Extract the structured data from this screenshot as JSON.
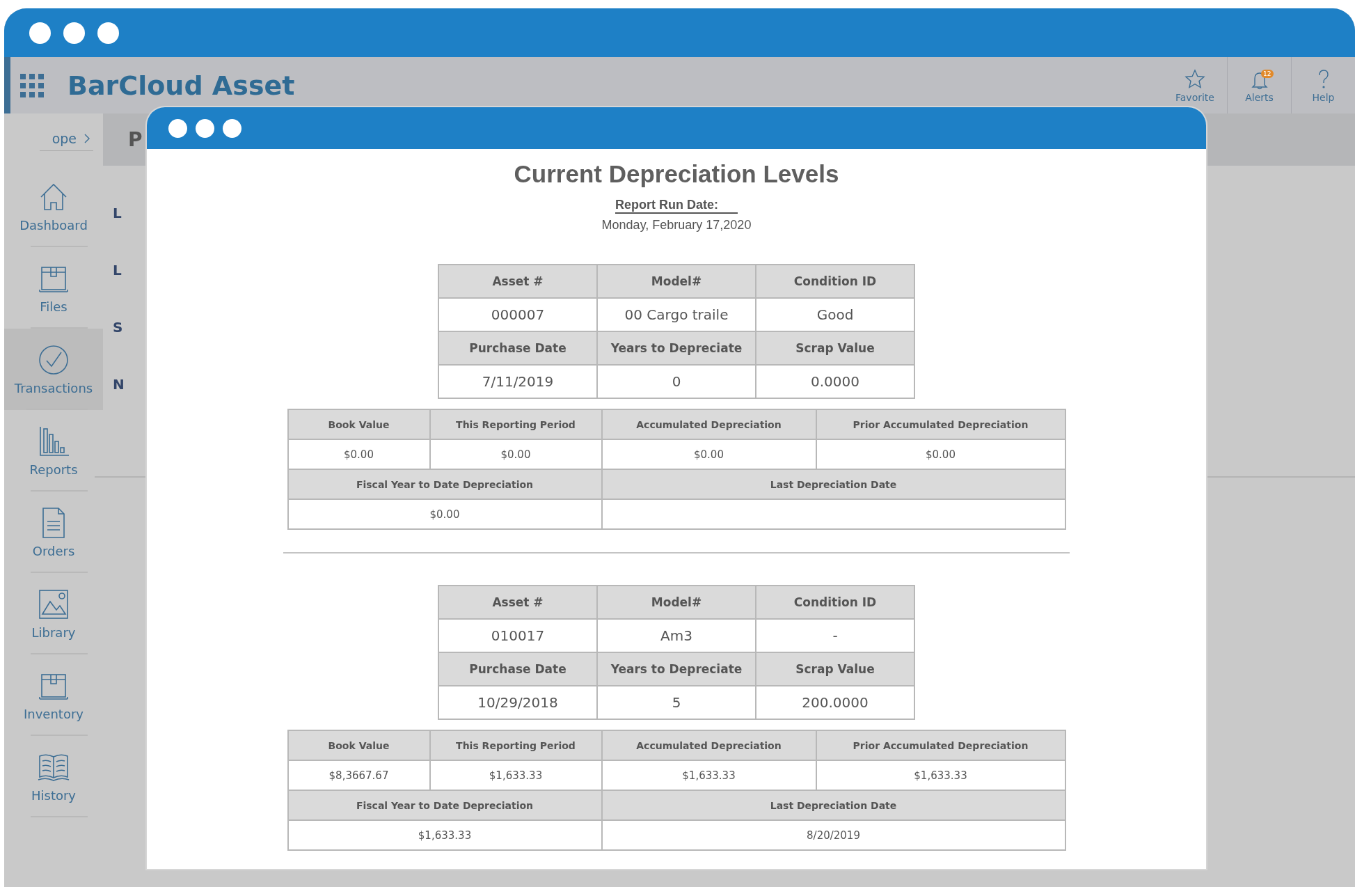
{
  "app": {
    "title": "BarCloud Asset"
  },
  "header_actions": [
    {
      "label": "Favorite",
      "kind": "star"
    },
    {
      "label": "Alerts",
      "kind": "bell",
      "badge": "12"
    },
    {
      "label": "Help",
      "kind": "help"
    }
  ],
  "breadcrumb": {
    "text": "ope"
  },
  "sidebar": {
    "items": [
      {
        "label": "Dashboard",
        "kind": "house",
        "selected": false
      },
      {
        "label": "Files",
        "kind": "box",
        "selected": false
      },
      {
        "label": "Transactions",
        "kind": "check",
        "selected": true
      },
      {
        "label": "Reports",
        "kind": "chart",
        "selected": false
      },
      {
        "label": "Orders",
        "kind": "document",
        "selected": false
      },
      {
        "label": "Library",
        "kind": "image",
        "selected": false
      },
      {
        "label": "Inventory",
        "kind": "box",
        "selected": false
      },
      {
        "label": "History",
        "kind": "book",
        "selected": false
      }
    ]
  },
  "background": {
    "subheader_text": "P",
    "row_labels": [
      "L",
      "L",
      "S",
      "N"
    ]
  },
  "report": {
    "title": "Current Depreciation Levels",
    "run_date_label": "Report Run Date:",
    "run_date": "Monday, February 17,2020",
    "assets": [
      {
        "details": [
          {
            "label": "Asset #",
            "value": "000007"
          },
          {
            "label": "Model#",
            "value": "00 Cargo traile"
          },
          {
            "label": "Condition ID",
            "value": "Good"
          },
          {
            "label": "Purchase Date",
            "value": "7/11/2019"
          },
          {
            "label": "Years to Depreciate",
            "value": "0"
          },
          {
            "label": "Scrap Value",
            "value": "0.0000"
          }
        ],
        "depreciation": [
          {
            "label": "Book Value",
            "value": "$0.00"
          },
          {
            "label": "This Reporting Period",
            "value": "$0.00"
          },
          {
            "label": "Accumulated Depreciation",
            "value": "$0.00"
          },
          {
            "label": "Prior Accumulated Depreciation",
            "value": "$0.00"
          },
          {
            "label": "Fiscal Year to Date Depreciation",
            "value": "$0.00"
          },
          {
            "label": "Last Depreciation Date"
          }
        ]
      },
      {
        "details": [
          {
            "label": "Asset #",
            "value": "010017"
          },
          {
            "label": "Model#",
            "value": "Am3"
          },
          {
            "label": "Condition ID",
            "value": "-"
          },
          {
            "label": "Purchase Date",
            "value": "10/29/2018"
          },
          {
            "label": "Years to Depreciate",
            "value": "5"
          },
          {
            "label": "Scrap Value",
            "value": "200.0000"
          }
        ],
        "depreciation": [
          {
            "label": "Book Value",
            "value": "$8,3667.67"
          },
          {
            "label": "This Reporting Period",
            "value": "$1,633.33"
          },
          {
            "label": "Accumulated Depreciation",
            "value": "$1,633.33"
          },
          {
            "label": "Prior Accumulated Depreciation",
            "value": "$1,633.33"
          },
          {
            "label": "Fiscal Year to Date Depreciation",
            "value": "$1,633.33"
          },
          {
            "label": "Last Depreciation Date",
            "value": "8/20/2019"
          }
        ]
      }
    ]
  }
}
